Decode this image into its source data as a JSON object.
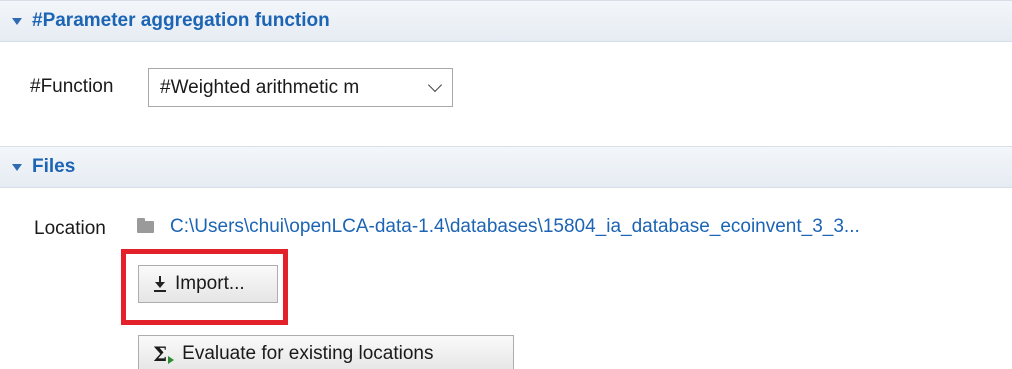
{
  "sections": {
    "aggregation": {
      "title": "#Parameter aggregation function"
    },
    "files": {
      "title": "Files"
    }
  },
  "function_field": {
    "label": "#Function",
    "value": "#Weighted arithmetic m"
  },
  "location": {
    "label": "Location",
    "path": "C:\\Users\\chui\\openLCA-data-1.4\\databases\\15804_ia_database_ecoinvent_3_3..."
  },
  "buttons": {
    "import": "Import...",
    "evaluate": "Evaluate for existing locations"
  },
  "icons": {
    "section_toggle": "triangle-down-icon",
    "combo_dropdown": "chevron-down-icon",
    "folder": "folder-icon",
    "import": "download-icon",
    "evaluate": "sigma-run-icon"
  },
  "colors": {
    "section_title": "#1c64b4",
    "link": "#1c64b4",
    "highlight": "#e3212a",
    "run_arrow": "#2e8b2e"
  }
}
